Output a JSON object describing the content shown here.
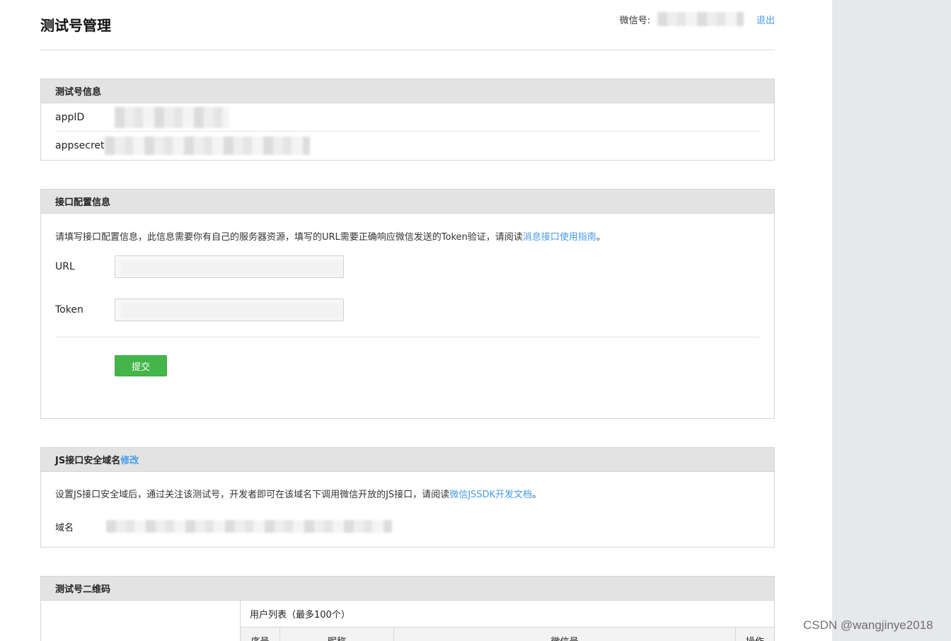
{
  "header": {
    "title": "测试号管理",
    "account_label": "微信号:",
    "logout_label": "退出"
  },
  "test_account_info": {
    "title": "测试号信息",
    "appid_label": "appID",
    "appsecret_label": "appsecret"
  },
  "interface_config": {
    "title": "接口配置信息",
    "description": "请填写接口配置信息，此信息需要你有自己的服务器资源，填写的URL需要正确响应微信发送的Token验证，请阅读",
    "guide_link": "消息接口使用指南",
    "period": "。",
    "url_label": "URL",
    "token_label": "Token",
    "submit_label": "提交"
  },
  "js_domain": {
    "title": "JS接口安全域名",
    "edit_link": "修改",
    "description": "设置JS接口安全域后，通过关注该测试号，开发者即可在该域名下调用微信开放的JS接口，请阅读",
    "doc_link": "微信JSSDK开发文档",
    "period": "。",
    "domain_label": "域名"
  },
  "qr_code": {
    "title": "测试号二维码",
    "user_list_title": "用户列表（最多100个）",
    "columns": [
      "序号",
      "昵称",
      "微信号",
      "操作"
    ]
  },
  "watermark": "CSDN @wangjinye2018",
  "colors": {
    "link": "#459ae9",
    "submit": "#44b549",
    "panel_header": "#e3e3e3",
    "side_gutter": "#e7e8eb"
  }
}
